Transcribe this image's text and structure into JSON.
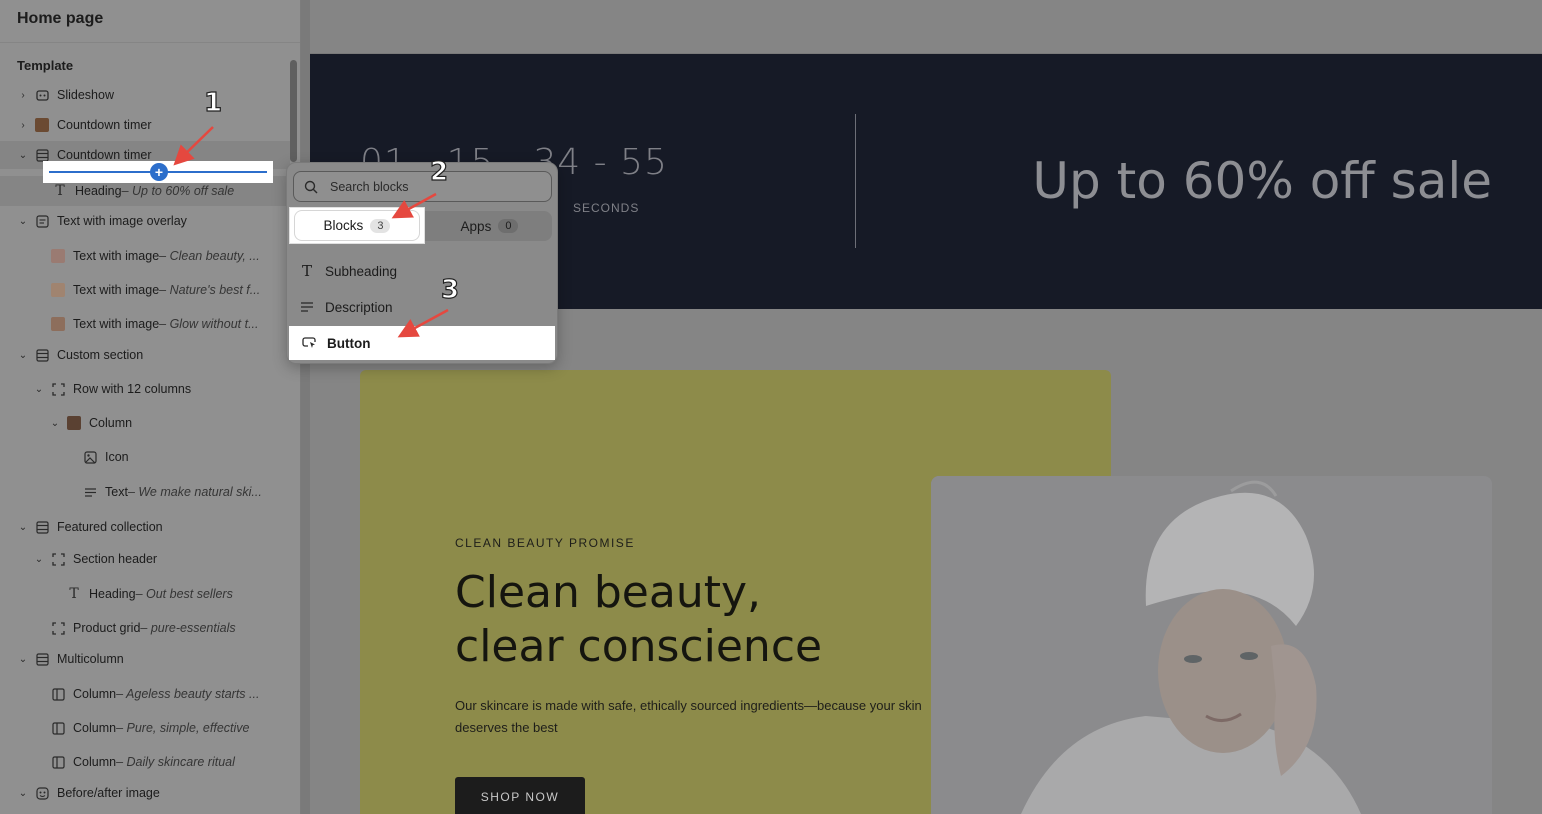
{
  "sidebar": {
    "title": "Home page",
    "section_label": "Template",
    "items": [
      {
        "label": "Slideshow",
        "sub": ""
      },
      {
        "label": "Countdown timer",
        "sub": ""
      },
      {
        "label": "Countdown timer",
        "sub": ""
      },
      {
        "label": "Heading",
        "sub": " – Up to 60% off sale"
      },
      {
        "label": "Text with image overlay",
        "sub": ""
      },
      {
        "label": "Text with image",
        "sub": " – Clean beauty, ..."
      },
      {
        "label": "Text with image",
        "sub": " – Nature's best f..."
      },
      {
        "label": "Text with image",
        "sub": " – Glow without t..."
      },
      {
        "label": "Custom section",
        "sub": ""
      },
      {
        "label": "Row with 12 columns",
        "sub": ""
      },
      {
        "label": "Column",
        "sub": ""
      },
      {
        "label": "Icon",
        "sub": ""
      },
      {
        "label": "Text",
        "sub": " – We make natural ski..."
      },
      {
        "label": "Featured collection",
        "sub": ""
      },
      {
        "label": "Section header",
        "sub": ""
      },
      {
        "label": "Heading",
        "sub": " – Out best sellers"
      },
      {
        "label": "Product grid",
        "sub": " – pure-essentials"
      },
      {
        "label": "Multicolumn",
        "sub": ""
      },
      {
        "label": "Column",
        "sub": " – Ageless beauty starts ..."
      },
      {
        "label": "Column",
        "sub": " – Pure, simple, effective"
      },
      {
        "label": "Column",
        "sub": " – Daily skincare ritual"
      },
      {
        "label": "Before/after image",
        "sub": ""
      }
    ]
  },
  "popover": {
    "search_placeholder": "Search blocks",
    "tabs": [
      {
        "label": "Blocks",
        "count": "3"
      },
      {
        "label": "Apps",
        "count": "0"
      }
    ],
    "items": [
      {
        "label": "Subheading"
      },
      {
        "label": "Description"
      },
      {
        "label": "Button"
      }
    ]
  },
  "preview": {
    "countdown": {
      "digits": "01 - 15 - 34 - 55",
      "seconds_label": "SECONDS",
      "sale_text": "Up to 60% off sale"
    },
    "promo": {
      "eyebrow": "CLEAN BEAUTY PROMISE",
      "title": "Clean beauty, clear conscience",
      "text": "Our skincare is made with safe, ethically sourced ingredients—because your skin deserves the best",
      "button": "SHOP NOW"
    }
  },
  "annotations": {
    "markers": [
      "1",
      "2",
      "3"
    ],
    "arrow_color": "#e5483f"
  },
  "colors": {
    "accent": "#2c6ecb",
    "countdown_bg": "#161a26",
    "promo_bg": "#d6d26f"
  }
}
